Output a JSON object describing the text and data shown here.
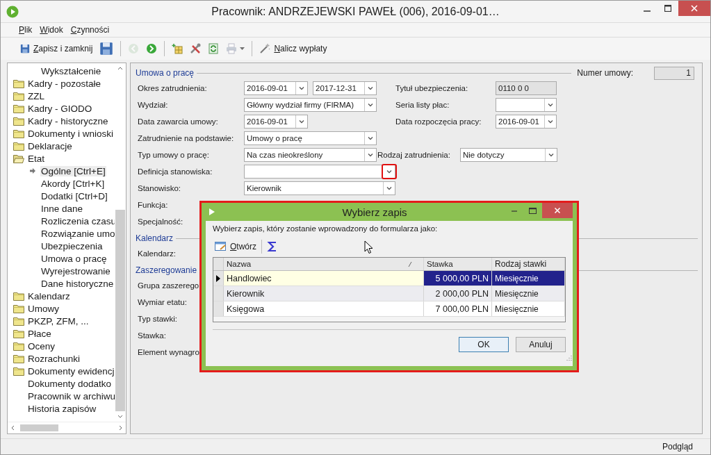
{
  "window": {
    "title": "Pracownik: ANDRZEJEWSKI PAWEŁ (006), 2016-09-01…"
  },
  "menu": [
    "Plik",
    "Widok",
    "Czynności"
  ],
  "toolbar": [
    {
      "kind": "save",
      "label": "Zapisz i zamknij",
      "disabled": false
    },
    {
      "kind": "save_as",
      "disabled": false
    },
    {
      "kind": "separator"
    },
    {
      "kind": "back",
      "disabled": true
    },
    {
      "kind": "forward",
      "disabled": false
    },
    {
      "kind": "separator"
    },
    {
      "kind": "chart",
      "disabled": false
    },
    {
      "kind": "tools",
      "disabled": false
    },
    {
      "kind": "refresh",
      "disabled": false
    },
    {
      "kind": "print",
      "disabled": true
    },
    {
      "kind": "separator"
    },
    {
      "kind": "wand",
      "label": "Nalicz wypłaty",
      "disabled": false
    }
  ],
  "tree": [
    {
      "label": "Wykształcenie",
      "kind": "child",
      "selected": false
    },
    {
      "label": "Kadry - pozostałe",
      "kind": "folder",
      "expanded": false
    },
    {
      "label": "ZZL",
      "kind": "folder",
      "expanded": false
    },
    {
      "label": "Kadry - GIODO",
      "kind": "folder",
      "expanded": false
    },
    {
      "label": "Kadry - historyczne",
      "kind": "folder",
      "expanded": false
    },
    {
      "label": "Dokumenty i wnioski",
      "kind": "folder",
      "expanded": false
    },
    {
      "label": "Deklaracje",
      "kind": "folder",
      "expanded": false
    },
    {
      "label": "Etat",
      "kind": "folder",
      "expanded": true,
      "children": [
        {
          "label": "Ogólne [Ctrl+E]",
          "selected": true
        },
        {
          "label": "Akordy [Ctrl+K]",
          "selected": false
        },
        {
          "label": "Dodatki [Ctrl+D]",
          "selected": false
        },
        {
          "label": "Inne dane",
          "selected": false
        },
        {
          "label": "Rozliczenia czasu",
          "selected": false
        },
        {
          "label": "Rozwiązanie umo",
          "selected": false
        },
        {
          "label": "Ubezpieczenia",
          "selected": false
        },
        {
          "label": "Umowa o pracę",
          "selected": false
        },
        {
          "label": "Wyrejestrowanie",
          "selected": false
        },
        {
          "label": "Dane historyczne",
          "selected": false
        }
      ]
    },
    {
      "label": "Kalendarz",
      "kind": "folder",
      "expanded": false
    },
    {
      "label": "Umowy",
      "kind": "folder",
      "expanded": false
    },
    {
      "label": "PKZP, ZFM, ...",
      "kind": "folder",
      "expanded": false
    },
    {
      "label": "Płace",
      "kind": "folder",
      "expanded": false
    },
    {
      "label": "Oceny",
      "kind": "folder",
      "expanded": false
    },
    {
      "label": "Rozrachunki",
      "kind": "folder",
      "expanded": false
    },
    {
      "label": "Dokumenty ewidencj",
      "kind": "folder",
      "expanded": false
    },
    {
      "label": "Dokumenty dodatko",
      "kind": "leaf"
    },
    {
      "label": "Pracownik w archiwu",
      "kind": "leaf"
    },
    {
      "label": "Historia zapisów",
      "kind": "leaf"
    }
  ],
  "form": {
    "sections": [
      {
        "title": "Umowa o pracę",
        "number_label": "Numer umowy:",
        "number_value": "1",
        "rows": [
          {
            "label": "Okres zatrudnienia:",
            "fields": [
              {
                "kind": "date",
                "value": "2016-09-01"
              },
              {
                "kind": "date",
                "value": "2017-12-31"
              }
            ],
            "right": {
              "label": "Tytuł ubezpieczenia:",
              "field": {
                "kind": "readonly",
                "value": "0110 0 0"
              }
            }
          },
          {
            "label": "Wydział:",
            "fields": [
              {
                "kind": "combo",
                "value": "Główny wydział firmy (FIRMA)"
              }
            ],
            "right": {
              "label": "Seria listy płac:",
              "field": {
                "kind": "short_combo"
              }
            }
          },
          {
            "label": "Data zawarcia umowy:",
            "fields": [
              {
                "kind": "date",
                "value": "2016-09-01"
              }
            ],
            "right": {
              "label": "Data rozpoczęcia pracy:",
              "field": {
                "kind": "short_combo",
                "value": "2016-09-01"
              }
            }
          },
          {
            "label": "Zatrudnienie na podstawie:",
            "fields": [
              {
                "kind": "combo",
                "value": "Umowy o pracę"
              }
            ]
          },
          {
            "label": "Typ umowy o pracę:",
            "fields": [
              {
                "kind": "combo",
                "value": "Na czas nieokreślony"
              }
            ],
            "right": {
              "label": "Rodzaj zatrudnienia:",
              "field": {
                "kind": "mid_combo",
                "value": "Nie dotyczy"
              }
            }
          },
          {
            "label": "Definicja stanowiska:",
            "fields": [
              {
                "kind": "wide_combo",
                "highlighted": true
              }
            ]
          },
          {
            "label": "Stanowisko:",
            "fields": [
              {
                "kind": "wide_combo",
                "value": "Kierownik",
                "highlighted": false
              }
            ]
          },
          {
            "label": "Funkcja:"
          },
          {
            "label": "Specjalność:"
          }
        ]
      },
      {
        "title": "Kalendarz",
        "rows": [
          {
            "label": "Kalendarz:"
          }
        ]
      },
      {
        "title": "Zaszeregowanie",
        "rows": [
          {
            "label": "Grupa zaszerego"
          },
          {
            "label": "Wymiar etatu:"
          },
          {
            "label": "Typ stawki:"
          },
          {
            "label": "Stawka:"
          },
          {
            "label": "Element wynagro"
          }
        ]
      }
    ]
  },
  "dialog": {
    "title": "Wybierz zapis",
    "highlighted": true,
    "prompt": "Wybierz zapis, który zostanie wprowadzony do formularza jako:",
    "toolbar": [
      {
        "kind": "open",
        "label": "Otwórz"
      },
      {
        "kind": "sum"
      }
    ],
    "columns": [
      {
        "label": "Nazwa",
        "sorted": true
      },
      {
        "label": "Stawka",
        "sorted": false
      },
      {
        "label": "Rodzaj stawki",
        "sorted": false
      }
    ],
    "rows": [
      {
        "cells": [
          "Handlowiec",
          "5 000,00 PLN",
          "Miesięcznie"
        ],
        "selected": true
      },
      {
        "cells": [
          "Kierownik",
          "2 000,00 PLN",
          "Miesięcznie"
        ],
        "selected": false
      },
      {
        "cells": [
          "Księgowa",
          "7 000,00 PLN",
          "Miesięcznie"
        ],
        "selected": false
      }
    ],
    "buttons": [
      {
        "label": "OK",
        "default": true
      },
      {
        "label": "Anuluj",
        "default": false
      }
    ]
  },
  "status_bar": {
    "text": "Podgląd"
  }
}
